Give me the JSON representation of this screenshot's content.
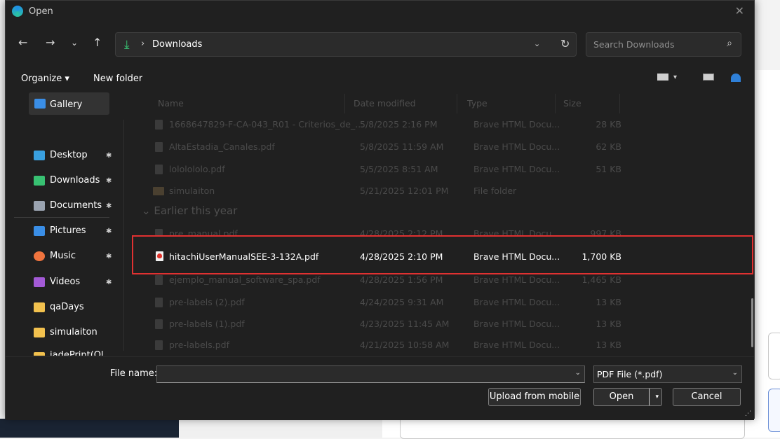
{
  "window": {
    "title": "Open",
    "close": "✕"
  },
  "nav": {
    "back": "←",
    "forward": "→",
    "recent": "⌄",
    "up": "↑"
  },
  "address": {
    "arrow": "⤓",
    "separator": "›",
    "crumb": "Downloads",
    "dropdown": "⌄",
    "refresh": "↻"
  },
  "search": {
    "placeholder": "Search Downloads",
    "icon": "⌕"
  },
  "commandbar": {
    "organize": "Organize ▾",
    "new_folder": "New folder"
  },
  "sidebar": {
    "items": [
      {
        "label": "Gallery",
        "icon": "gallery-icon",
        "color": "#3a8ee6",
        "selected": true
      },
      {
        "label": "Desktop",
        "icon": "desktop-icon",
        "color": "#39a0e0",
        "pin": "✱"
      },
      {
        "label": "Downloads",
        "icon": "downloads-icon",
        "color": "#38c172",
        "pin": "✱"
      },
      {
        "label": "Documents",
        "icon": "documents-icon",
        "color": "#9aa3b0",
        "pin": "✱"
      },
      {
        "label": "Pictures",
        "icon": "pictures-icon",
        "color": "#3a8ee6",
        "pin": "✱"
      },
      {
        "label": "Music",
        "icon": "music-icon",
        "color": "#f0743e",
        "pin": "✱"
      },
      {
        "label": "Videos",
        "icon": "videos-icon",
        "color": "#a35ad6",
        "pin": "✱"
      },
      {
        "label": "qaDays",
        "icon": "folder-icon",
        "color": "#f2c14e"
      },
      {
        "label": "simulaiton",
        "icon": "folder-icon",
        "color": "#f2c14e"
      },
      {
        "label": "jadePrint(Ol",
        "icon": "folder-icon",
        "color": "#f2c14e"
      }
    ]
  },
  "columns": {
    "name": "Name",
    "date": "Date modified",
    "type": "Type",
    "size": "Size"
  },
  "files_recent": [
    {
      "name": "1668647829-F-CA-043_R01 - Criterios_de_...",
      "date": "5/8/2025 2:16 PM",
      "type": "Brave HTML Docu...",
      "size": "28 KB"
    },
    {
      "name": "AltaEstadia_Canales.pdf",
      "date": "5/8/2025 11:59 AM",
      "type": "Brave HTML Docu...",
      "size": "62 KB"
    },
    {
      "name": "lololololo.pdf",
      "date": "5/5/2025 8:51 AM",
      "type": "Brave HTML Docu...",
      "size": "51 KB"
    },
    {
      "name": "simulaiton",
      "date": "5/21/2025 12:01 PM",
      "type": "File folder",
      "size": ""
    }
  ],
  "group_earlier": {
    "chevron": "⌄",
    "label": "Earlier this year"
  },
  "files_earlier": [
    {
      "name": "pre_manual.pdf",
      "date": "4/28/2025 2:12 PM",
      "type": "Brave HTML Docu...",
      "size": "997 KB"
    },
    {
      "name": "hitachiUserManualSEE-3-132A.pdf",
      "date": "4/28/2025 2:10 PM",
      "type": "Brave HTML Docu...",
      "size": "1,700 KB"
    },
    {
      "name": "ejemplo_manual_software_spa.pdf",
      "date": "4/28/2025 1:56 PM",
      "type": "Brave HTML Docu...",
      "size": "1,465 KB"
    },
    {
      "name": "pre-labels (2).pdf",
      "date": "4/24/2025 9:31 AM",
      "type": "Brave HTML Docu...",
      "size": "13 KB"
    },
    {
      "name": "pre-labels (1).pdf",
      "date": "4/23/2025 11:45 AM",
      "type": "Brave HTML Docu...",
      "size": "13 KB"
    },
    {
      "name": "pre-labels.pdf",
      "date": "4/21/2025 10:58 AM",
      "type": "Brave HTML Docu...",
      "size": "13 KB"
    }
  ],
  "footer": {
    "file_name_label": "File name:",
    "file_name_value": "",
    "dropdown": "⌄",
    "file_type": "PDF File (*.pdf)",
    "upload_label": "Upload from mobile",
    "open_label": "Open",
    "open_dd": "▾",
    "cancel_label": "Cancel",
    "grip": "⋰"
  }
}
